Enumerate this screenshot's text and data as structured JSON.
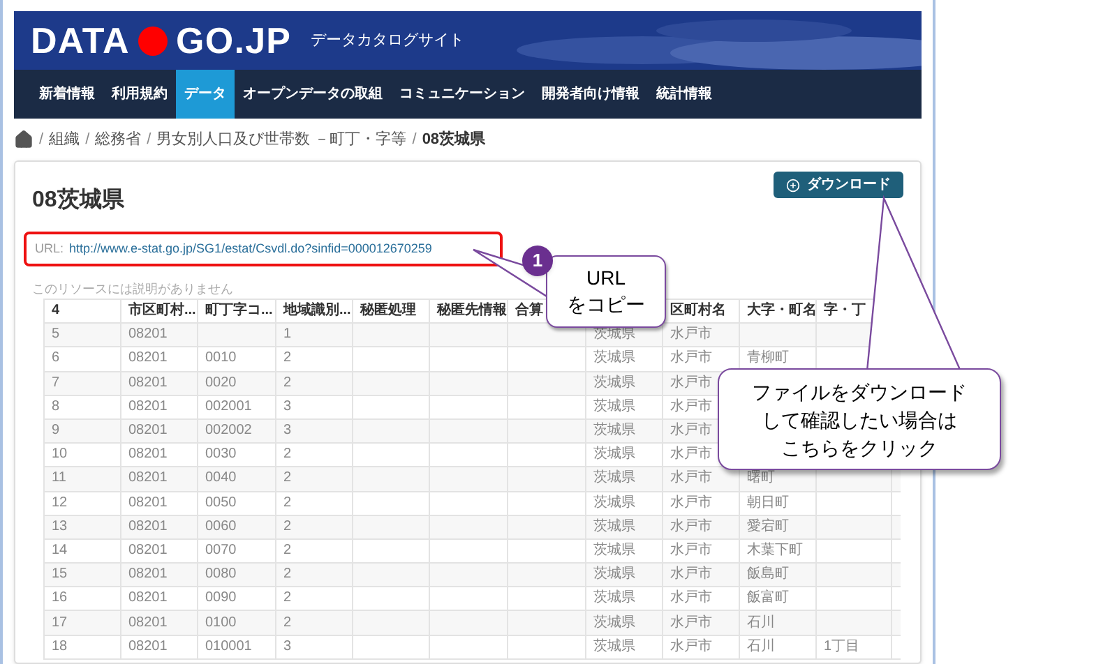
{
  "site": {
    "logo_left": "DATA",
    "logo_right": "GO.JP",
    "tagline": "データカタログサイト"
  },
  "nav": [
    {
      "label": "新着情報",
      "selected": false
    },
    {
      "label": "利用規約",
      "selected": false
    },
    {
      "label": "データ",
      "selected": true
    },
    {
      "label": "オープンデータの取組",
      "selected": false
    },
    {
      "label": "コミュニケーション",
      "selected": false
    },
    {
      "label": "開発者向け情報",
      "selected": false
    },
    {
      "label": "統計情報",
      "selected": false
    }
  ],
  "breadcrumb": {
    "separator": "/",
    "items": [
      "組織",
      "総務省",
      "男女別人口及び世帯数 －町丁・字等",
      "08茨城県"
    ]
  },
  "resource": {
    "title": "08茨城県",
    "download": "ダウンロード",
    "url_label": "URL:",
    "url": "http://www.e-stat.go.jp/SG1/estat/Csvdl.do?sinfid=000012670259",
    "description": "このリソースには説明がありません"
  },
  "table": {
    "header": {
      "no": "4",
      "city_code": "市区町村...",
      "town_code": "町丁字コ...",
      "area_type": "地域識別...",
      "secrecy": "秘匿処理",
      "secrecy_info": "秘匿先情報",
      "merged": "合算",
      "municipality": "区町村名",
      "town": "大字・町名",
      "chome": "字・丁"
    },
    "rows": [
      {
        "no": "5",
        "city_code": "08201",
        "area_type": "1",
        "prefecture": "茨城県",
        "municipality": "水戸市"
      },
      {
        "no": "6",
        "city_code": "08201",
        "town_code": "0010",
        "area_type": "2",
        "prefecture": "茨城県",
        "municipality": "水戸市",
        "town": "青柳町"
      },
      {
        "no": "7",
        "city_code": "08201",
        "town_code": "0020",
        "area_type": "2",
        "prefecture": "茨城県",
        "municipality": "水戸市"
      },
      {
        "no": "8",
        "city_code": "08201",
        "town_code": "002001",
        "area_type": "3",
        "prefecture": "茨城県",
        "municipality": "水戸市"
      },
      {
        "no": "9",
        "city_code": "08201",
        "town_code": "002002",
        "area_type": "3",
        "prefecture": "茨城県",
        "municipality": "水戸市"
      },
      {
        "no": "10",
        "city_code": "08201",
        "town_code": "0030",
        "area_type": "2",
        "prefecture": "茨城県",
        "municipality": "水戸市"
      },
      {
        "no": "11",
        "city_code": "08201",
        "town_code": "0040",
        "area_type": "2",
        "prefecture": "茨城県",
        "municipality": "水戸市",
        "town": "曙町"
      },
      {
        "no": "12",
        "city_code": "08201",
        "town_code": "0050",
        "area_type": "2",
        "prefecture": "茨城県",
        "municipality": "水戸市",
        "town": "朝日町"
      },
      {
        "no": "13",
        "city_code": "08201",
        "town_code": "0060",
        "area_type": "2",
        "prefecture": "茨城県",
        "municipality": "水戸市",
        "town": "愛宕町"
      },
      {
        "no": "14",
        "city_code": "08201",
        "town_code": "0070",
        "area_type": "2",
        "prefecture": "茨城県",
        "municipality": "水戸市",
        "town": "木葉下町"
      },
      {
        "no": "15",
        "city_code": "08201",
        "town_code": "0080",
        "area_type": "2",
        "prefecture": "茨城県",
        "municipality": "水戸市",
        "town": "飯島町"
      },
      {
        "no": "16",
        "city_code": "08201",
        "town_code": "0090",
        "area_type": "2",
        "prefecture": "茨城県",
        "municipality": "水戸市",
        "town": "飯富町"
      },
      {
        "no": "17",
        "city_code": "08201",
        "town_code": "0100",
        "area_type": "2",
        "prefecture": "茨城県",
        "municipality": "水戸市",
        "town": "石川"
      },
      {
        "no": "18",
        "city_code": "08201",
        "town_code": "010001",
        "area_type": "3",
        "prefecture": "茨城県",
        "municipality": "水戸市",
        "town": "石川",
        "chome": "1丁目"
      }
    ]
  },
  "callouts": [
    {
      "badge": "1",
      "lines": [
        "URL",
        "をコピー"
      ]
    },
    {
      "lines": [
        "ファイルをダウンロード",
        "して確認したい場合は",
        "こちらをクリック"
      ]
    }
  ]
}
